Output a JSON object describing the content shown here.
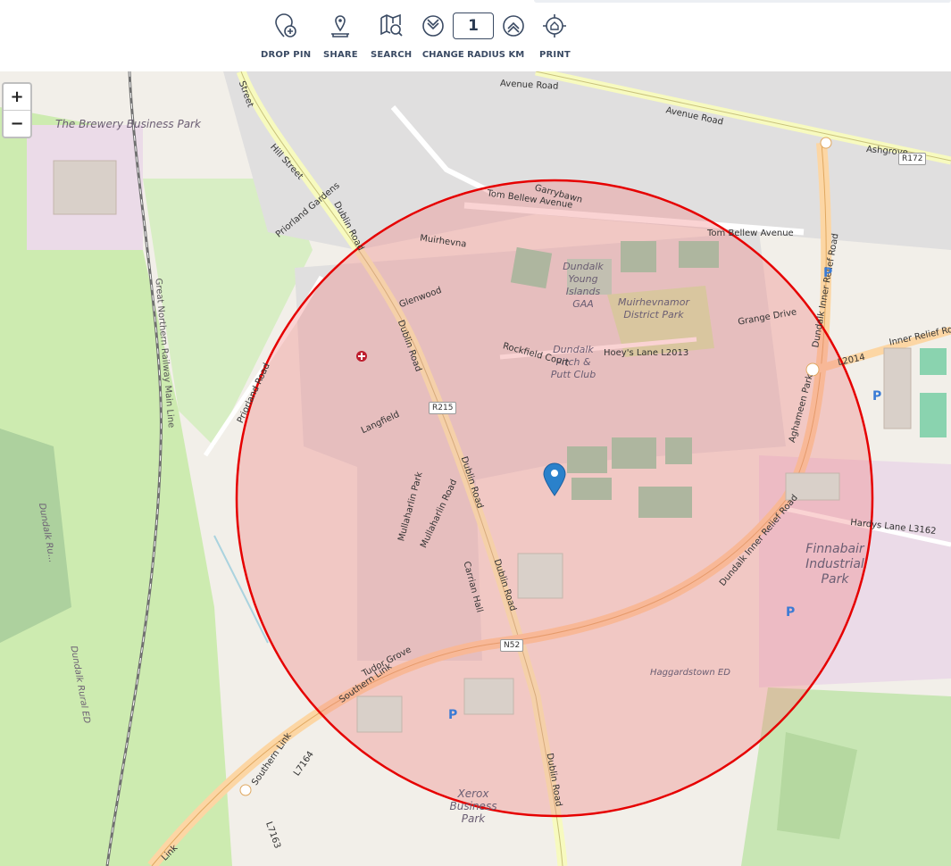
{
  "toolbar": {
    "drop_pin": "DROP PIN",
    "share": "SHARE",
    "search": "SEARCH",
    "change_radius": "CHANGE RADIUS KM",
    "radius_value": "1",
    "print": "PRINT"
  },
  "zoom": {
    "in": "+",
    "out": "−"
  },
  "map": {
    "labels": {
      "brewery": "The Brewery Business Park",
      "dundalk_gaa": "Dundalk Young Islands GAA",
      "muirhevnamor": "Muirhevnamor District Park",
      "pitch_putt": "Dundalk Pitch & Putt Club",
      "finnabair": "Finnabair Industrial Park",
      "xerox": "Xerox Business Park",
      "haggardstown": "Haggardstown ED",
      "dundalk_rural": "Dundalk Rural ED",
      "dundalk_ru": "Dundalk Ru...",
      "railway": "Great Northern Railway Main Line",
      "avenue_road": "Avenue Road",
      "avenue_road2": "Avenue Road",
      "tom_bellew": "Tom Bellew Avenue",
      "tom_bellew2": "Tom Bellew Avenue",
      "dublin_road1": "Dublin Road",
      "dublin_road2": "Dublin Road",
      "dublin_road3": "Dublin Road",
      "dublin_road4": "Dublin Road",
      "dublin_road5": "Dublin Road",
      "hill_street": "Hill Street",
      "southern_link": "Southern Link",
      "southern_link2": "Southern Link",
      "southern_link3": "Link",
      "inner_relief": "Dundalk Inner Relief Road",
      "inner_relief2": "Dundalk Inner Relief Road",
      "inner_relief3": "Inner Relief Road",
      "hardys_lane": "Hardys Lane L3162",
      "hoeys_lane": "Hoey's Lane L2013",
      "glenwood": "Glenwood",
      "muirhevna": "Muirhevna",
      "langfield": "Langfield",
      "mullaharlin_park": "Mullaharlin Park",
      "mullaharlin_road": "Mullaharlin Road",
      "rockfield_court": "Rockfield Court",
      "grange_drive": "Grange Drive",
      "aghameen_park": "Aghameen Park",
      "priorland_road": "Priorland Road",
      "priorland_gardens": "Priorland Gardens",
      "ashgrove": "Ashgrove",
      "tudor_grove": "Tudor Grove",
      "carrian_hall": "Carrian Hall",
      "garrybawn": "Garrybawn",
      "l2014": "L2014",
      "l7164": "L7164",
      "l7163": "L7163",
      "dublin_st": "Street"
    },
    "shields": {
      "r215": "R215",
      "n52": "N52",
      "r172": "R172"
    },
    "parking": "P",
    "circle_color": "#e60000",
    "circle_fill": "#f08080",
    "pin_color": "#2a81cb"
  }
}
